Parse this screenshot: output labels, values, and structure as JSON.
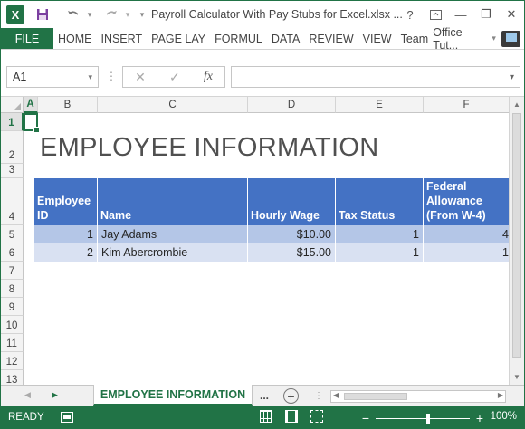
{
  "window": {
    "title": "Payroll Calculator With Pay Stubs for Excel.xlsx ...",
    "app_icon": "X",
    "help_label": "?",
    "minimize_label": "—",
    "restore_label": "❐",
    "close_label": "✕"
  },
  "quick_access": {
    "save_icon": "floppy-disk-icon",
    "undo_icon": "undo-arrow-icon",
    "redo_icon": "redo-arrow-icon"
  },
  "ribbon": {
    "file_label": "FILE",
    "tabs": [
      "HOME",
      "INSERT",
      "PAGE LAY",
      "FORMUL",
      "DATA",
      "REVIEW",
      "VIEW",
      "Team"
    ],
    "account_label": "Office Tut...",
    "account_arrow": "▾"
  },
  "formula_bar": {
    "name_box_value": "A1",
    "name_box_arrow": "▾",
    "cancel_label": "✕",
    "enter_label": "✓",
    "fx_label": "fx",
    "formula_value": "",
    "expand_arrow": "▾"
  },
  "columns": [
    "A",
    "B",
    "C",
    "D",
    "E",
    "F"
  ],
  "rows": [
    "1",
    "2",
    "3",
    "4",
    "5",
    "6",
    "7",
    "8",
    "9",
    "10",
    "11",
    "12",
    "13"
  ],
  "selected_cell": "A1",
  "sheet": {
    "title": "EMPLOYEE INFORMATION",
    "headers": [
      "Employee ID",
      "Name",
      "Hourly Wage",
      "Tax Status",
      "Federal Allowance (From W-4)"
    ],
    "data_rows": [
      {
        "id": "1",
        "name": "Jay Adams",
        "wage": "$10.00",
        "tax_status": "1",
        "allowance": "4"
      },
      {
        "id": "2",
        "name": "Kim Abercrombie",
        "wage": "$15.00",
        "tax_status": "1",
        "allowance": "1"
      }
    ]
  },
  "sheet_tabs": {
    "active_tab": "EMPLOYEE INFORMATION",
    "more_label": "...",
    "add_label": "+"
  },
  "status_bar": {
    "status": "READY",
    "zoom_minus": "−",
    "zoom_plus": "+",
    "zoom_level": "100%"
  },
  "colors": {
    "excel_green": "#217346",
    "header_blue": "#4472C4",
    "row_band_dark": "#B4C6E7",
    "row_band_light": "#D9E1F2"
  }
}
